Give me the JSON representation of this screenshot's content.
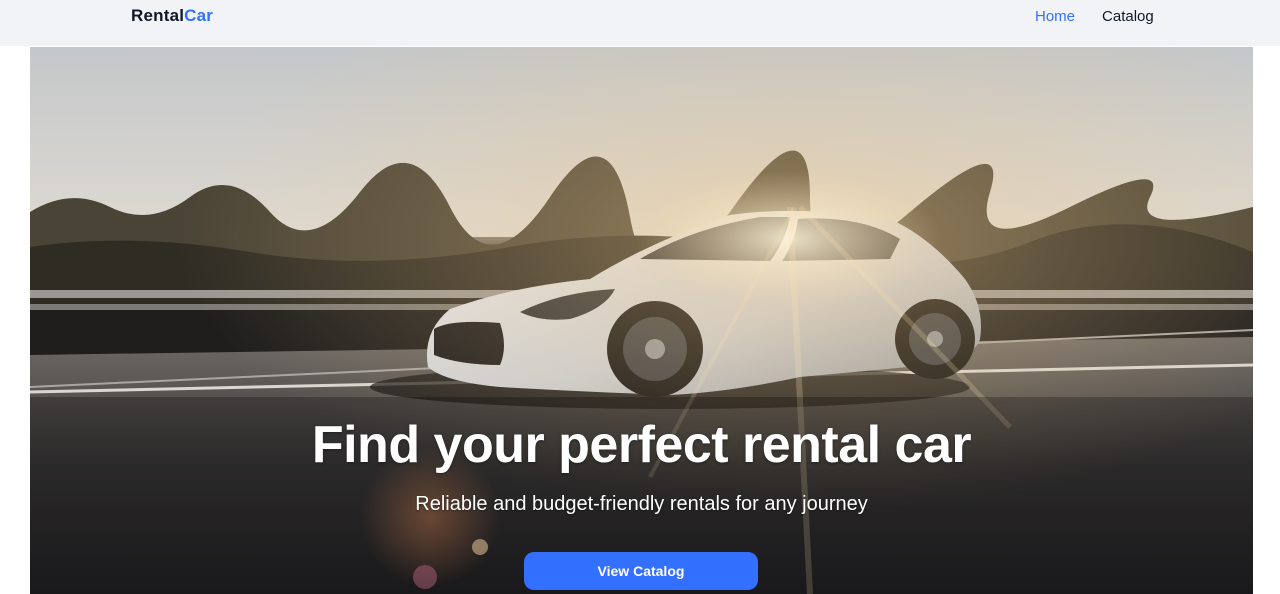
{
  "header": {
    "logo_part1": "Rental",
    "logo_part2": "Car",
    "nav": {
      "home": "Home",
      "catalog": "Catalog"
    }
  },
  "hero": {
    "title": "Find your perfect rental car",
    "subtitle": "Reliable and budget-friendly rentals for any journey",
    "cta_label": "View Catalog"
  },
  "colors": {
    "accent": "#3470ff",
    "header_bg": "#f2f3f6",
    "text_dark": "#101828"
  }
}
